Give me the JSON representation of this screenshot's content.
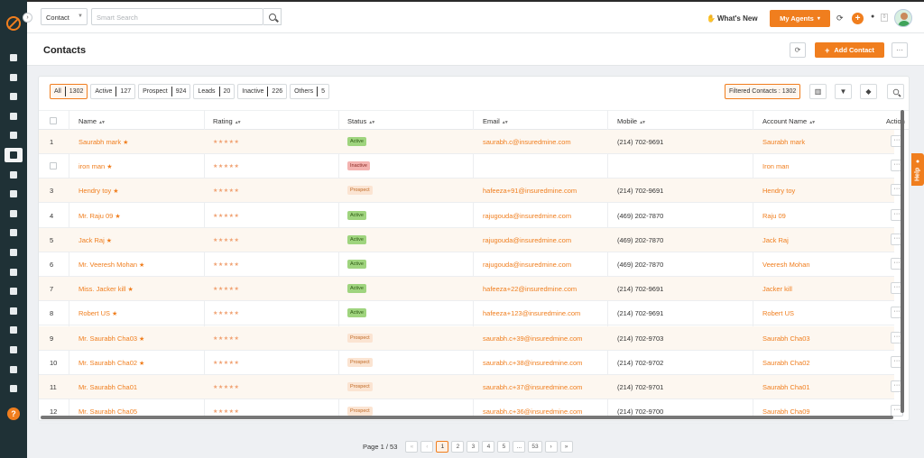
{
  "sidebar": {
    "items": [
      {
        "icon": "dashboard-icon",
        "active": false
      },
      {
        "icon": "users-icon",
        "active": false
      },
      {
        "icon": "documents-icon",
        "active": false
      },
      {
        "icon": "bank-icon",
        "active": false
      },
      {
        "icon": "list-icon",
        "active": false
      },
      {
        "icon": "contacts-icon",
        "active": true
      },
      {
        "icon": "funnel-icon",
        "active": false
      },
      {
        "icon": "megaphone-icon",
        "active": false
      },
      {
        "icon": "file-icon",
        "active": false
      },
      {
        "icon": "bar-chart-icon",
        "active": false
      },
      {
        "icon": "folder-icon",
        "active": false
      },
      {
        "icon": "google-icon",
        "active": false
      },
      {
        "icon": "calculator-icon",
        "active": false
      },
      {
        "icon": "calendar-icon",
        "active": false
      },
      {
        "icon": "mail-icon",
        "active": false
      },
      {
        "icon": "handshake-icon",
        "active": false
      },
      {
        "icon": "analytics-icon",
        "active": false
      },
      {
        "icon": "settings-icon",
        "active": false
      }
    ],
    "help_glyph": "?"
  },
  "topbar": {
    "module_select": "Contact",
    "search_placeholder": "Smart Search",
    "whats_new": "What's New",
    "my_agents": "My Agents",
    "badge_count": "0"
  },
  "page": {
    "title": "Contacts",
    "add_contact": "Add Contact",
    "add_plus": "+",
    "more_glyph": "···"
  },
  "filters": [
    {
      "label": "All",
      "count": "1302",
      "selected": true
    },
    {
      "label": "Active",
      "count": "127",
      "selected": false
    },
    {
      "label": "Prospect",
      "count": "924",
      "selected": false
    },
    {
      "label": "Leads",
      "count": "20",
      "selected": false
    },
    {
      "label": "Inactive",
      "count": "226",
      "selected": false
    },
    {
      "label": "Others",
      "count": "5",
      "selected": false
    }
  ],
  "filtered_contacts": "Filtered Contacts : 1302",
  "table": {
    "columns": [
      "Name",
      "Rating",
      "Status",
      "Email",
      "Mobile",
      "Account Name",
      "Action"
    ],
    "rows": [
      {
        "num": "1",
        "name": "Saurabh mark",
        "rating": "★★★★★",
        "status": "Active",
        "email": "saurabh.c@insuredmine.com",
        "mobile": "(214) 702-9691",
        "account": "Saurabh mark"
      },
      {
        "num": "",
        "name": "iron man",
        "rating": "★★★★★",
        "status": "Inactive",
        "email": "",
        "mobile": "",
        "account": "Iron man"
      },
      {
        "num": "3",
        "name": "Hendry toy",
        "rating": "★★★★★",
        "status": "Prospect",
        "email": "hafeeza+91@insuredmine.com",
        "mobile": "(214) 702-9691",
        "account": "Hendry toy"
      },
      {
        "num": "4",
        "name": "Mr. Raju 09",
        "rating": "★★★★★",
        "status": "Active",
        "email": "rajugouda@insuredmine.com",
        "mobile": "(469) 202-7870",
        "account": "Raju 09"
      },
      {
        "num": "5",
        "name": "Jack Raj",
        "rating": "★★★★★",
        "status": "Active",
        "email": "rajugouda@insuredmine.com",
        "mobile": "(469) 202-7870",
        "account": "Jack Raj"
      },
      {
        "num": "6",
        "name": "Mr. Veeresh Mohan",
        "rating": "★★★★★",
        "status": "Active",
        "email": "rajugouda@insuredmine.com",
        "mobile": "(469) 202-7870",
        "account": "Veeresh Mohan"
      },
      {
        "num": "7",
        "name": "Miss. Jacker kill",
        "rating": "★★★★★",
        "status": "Active",
        "email": "hafeeza+22@insuredmine.com",
        "mobile": "(214) 702-9691",
        "account": "Jacker kill"
      },
      {
        "num": "8",
        "name": "Robert US",
        "rating": "★★★★★",
        "status": "Active",
        "email": "hafeeza+123@insuredmine.com",
        "mobile": "(214) 702-9691",
        "account": "Robert US"
      },
      {
        "num": "9",
        "name": "Mr. Saurabh Cha03",
        "rating": "★★★★★",
        "status": "Prospect",
        "email": "saurabh.c+39@insuredmine.com",
        "mobile": "(214) 702-9703",
        "account": "Saurabh Cha03"
      },
      {
        "num": "10",
        "name": "Mr. Saurabh Cha02",
        "rating": "★★★★★",
        "status": "Prospect",
        "email": "saurabh.c+38@insuredmine.com",
        "mobile": "(214) 702-9702",
        "account": "Saurabh Cha02"
      },
      {
        "num": "11",
        "name": "Mr. Saurabh Cha01",
        "rating": "★★★★★",
        "status": "Prospect",
        "email": "saurabh.c+37@insuredmine.com",
        "mobile": "(214) 702-9701",
        "account": "Saurabh Cha01"
      },
      {
        "num": "12",
        "name": "Mr. Saurabh Cha05",
        "rating": "★★★★★",
        "status": "Prospect",
        "email": "saurabh.c+36@insuredmine.com",
        "mobile": "(214) 702-9700",
        "account": "Saurabh Cha09"
      }
    ],
    "starred": [
      true,
      true,
      true,
      true,
      true,
      true,
      true,
      true,
      true,
      true,
      false,
      false
    ]
  },
  "help_tab": "Help",
  "pagination": {
    "label": "Page 1 / 53",
    "buttons": [
      "«",
      "‹",
      "1",
      "2",
      "3",
      "4",
      "5",
      "...",
      "53",
      "›",
      "»"
    ],
    "current": "1"
  },
  "colors": {
    "accent": "#f07e1e",
    "sidebar": "#1f3136",
    "active_badge": "#9fd47e",
    "inactive_badge": "#f4b3b0",
    "prospect_badge": "#fbe4d2"
  }
}
